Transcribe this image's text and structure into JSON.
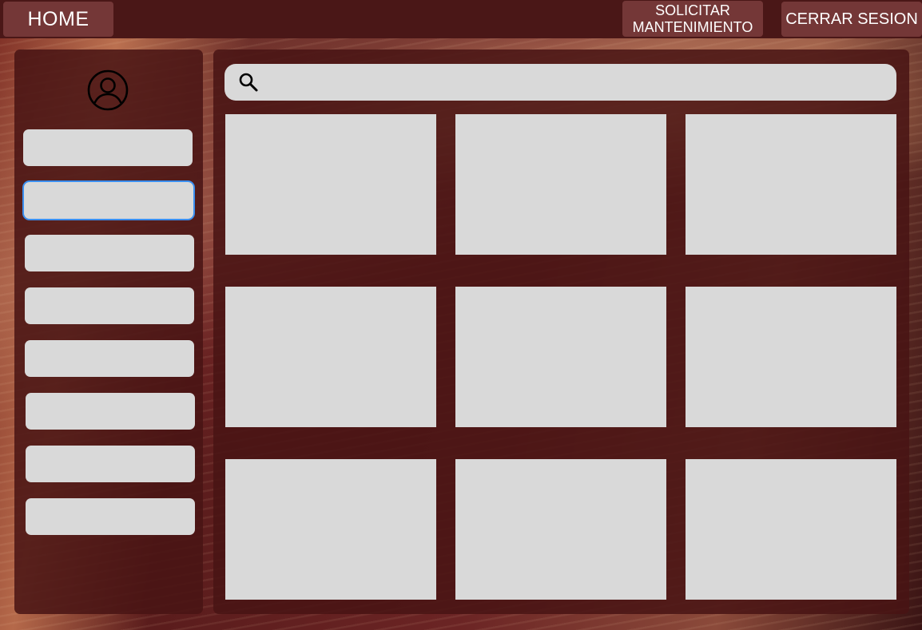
{
  "topbar": {
    "home_label": "HOME",
    "maintenance_label_line1": "SOLICITAR",
    "maintenance_label_line2": "MANTENIMIENTO",
    "logout_label": "CERRAR SESION"
  },
  "sidebar": {
    "avatar_icon": "user-circle-icon",
    "items": [
      {
        "label": ""
      },
      {
        "label": "",
        "selected": true
      },
      {
        "label": ""
      },
      {
        "label": ""
      },
      {
        "label": ""
      },
      {
        "label": ""
      },
      {
        "label": ""
      },
      {
        "label": ""
      }
    ]
  },
  "search": {
    "icon": "search-icon",
    "value": "",
    "placeholder": ""
  },
  "grid": {
    "cards": [
      {
        "label": ""
      },
      {
        "label": ""
      },
      {
        "label": ""
      },
      {
        "label": ""
      },
      {
        "label": ""
      },
      {
        "label": ""
      },
      {
        "label": ""
      },
      {
        "label": ""
      },
      {
        "label": ""
      }
    ]
  },
  "colors": {
    "topbar": "#4a1717",
    "button": "#743737",
    "panel": "#481414",
    "placeholder_block": "#d9d9d9",
    "selection_outline": "#3b8ff0"
  }
}
